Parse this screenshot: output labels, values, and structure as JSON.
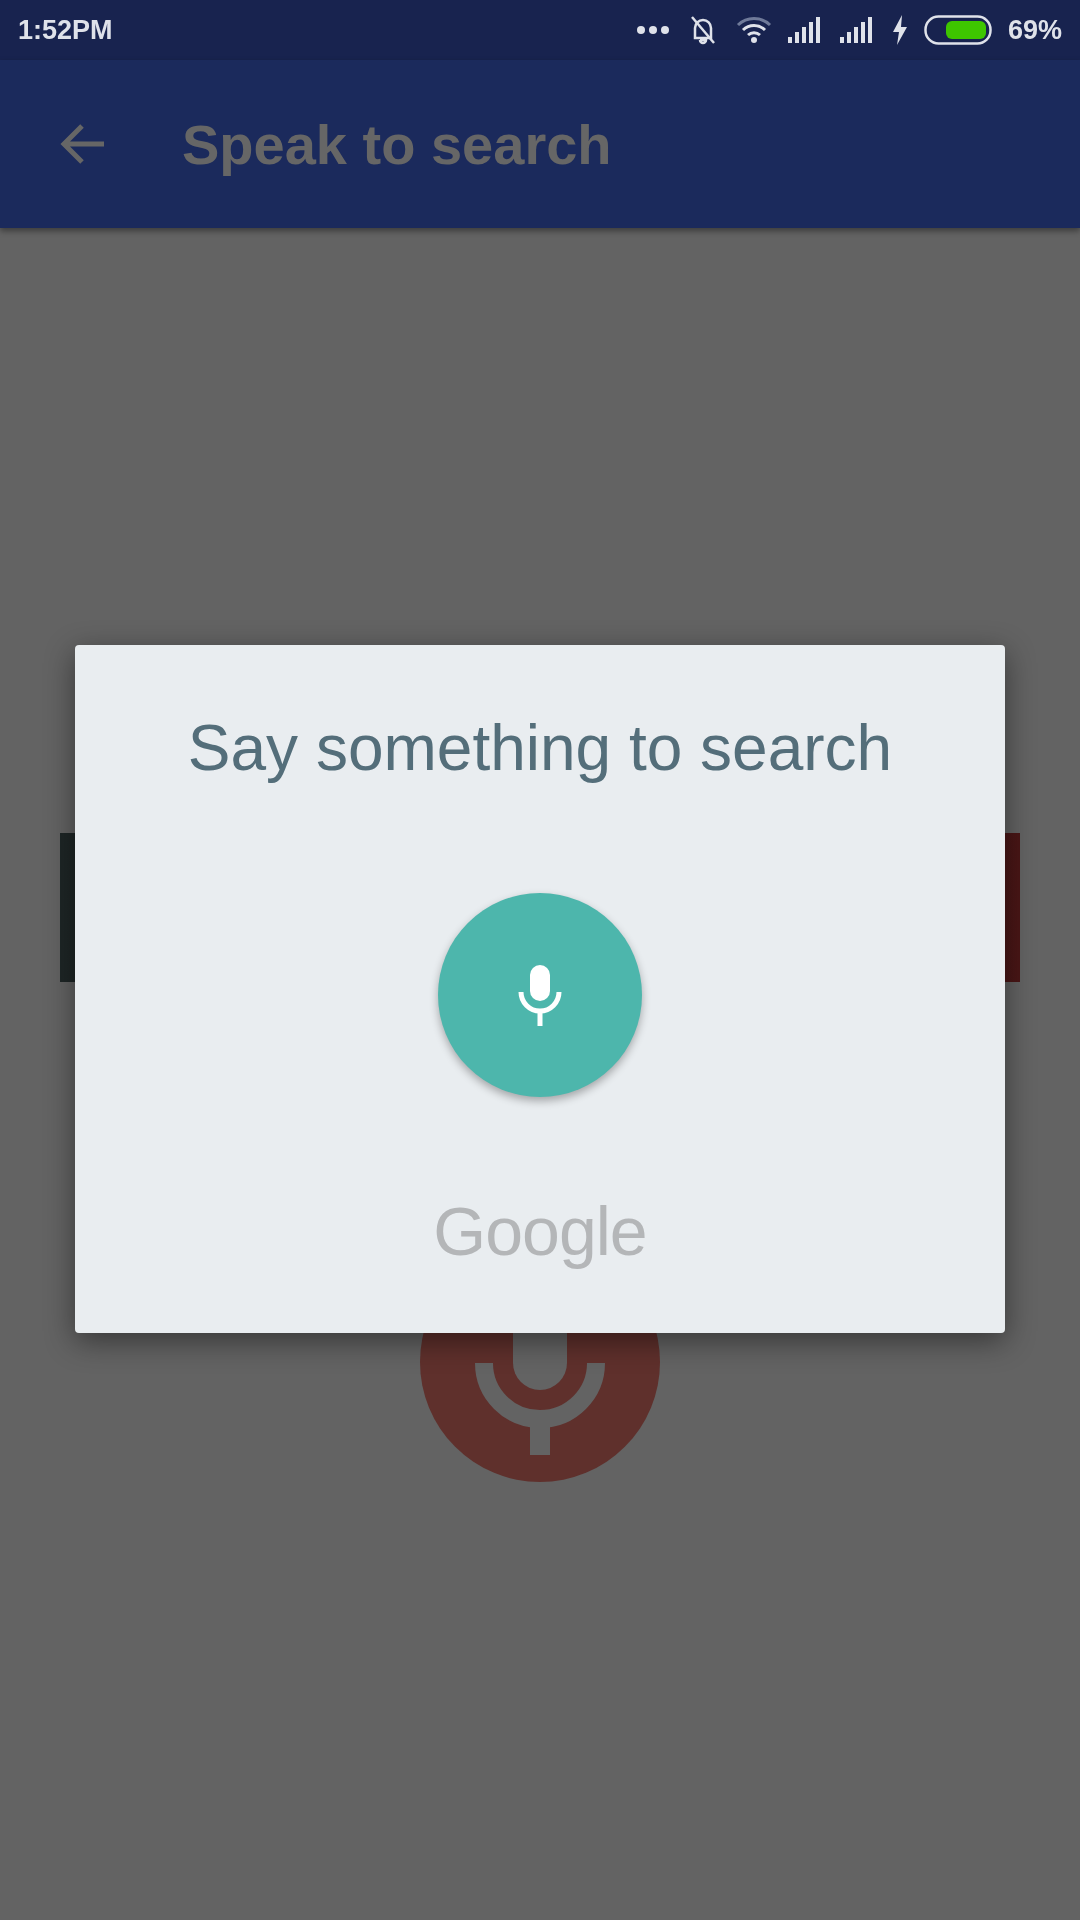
{
  "status_bar": {
    "time": "1:52PM",
    "battery": "69%"
  },
  "app_bar": {
    "title": "Speak to search"
  },
  "dialog": {
    "title": "Say something to search",
    "brand": "Google"
  }
}
